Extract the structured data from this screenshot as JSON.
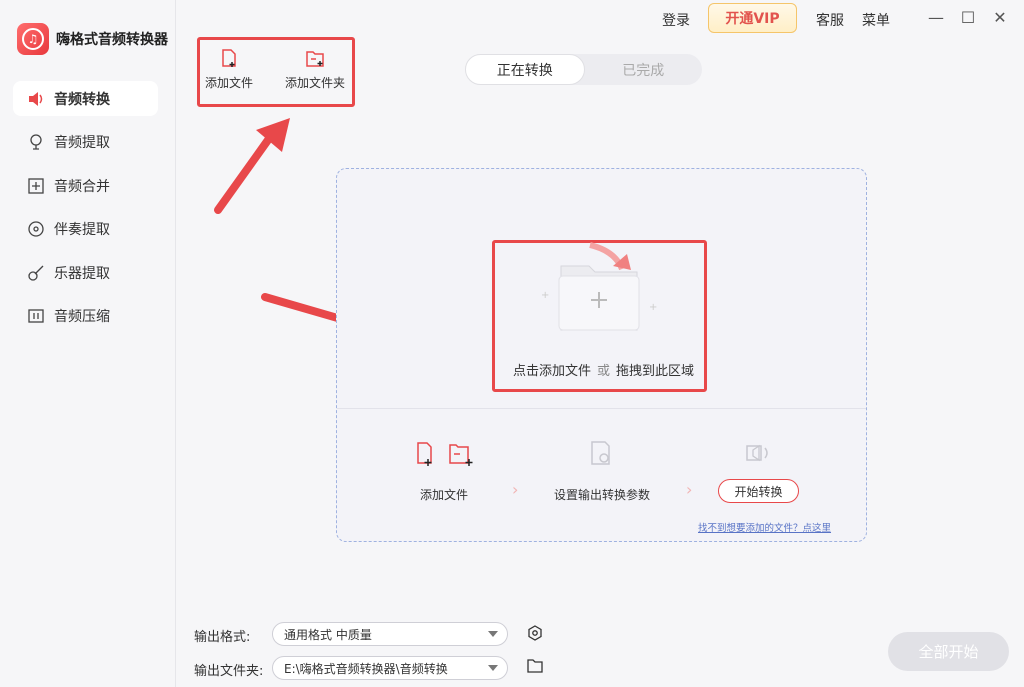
{
  "app": {
    "title": "嗨格式音频转换器"
  },
  "topbar": {
    "login": "登录",
    "vip": "开通VIP",
    "service": "客服",
    "menu": "菜单"
  },
  "sidebar": {
    "items": [
      {
        "label": "音频转换",
        "icon": "speaker-convert-icon"
      },
      {
        "label": "音频提取",
        "icon": "mic-extract-icon"
      },
      {
        "label": "音频合并",
        "icon": "merge-icon"
      },
      {
        "label": "伴奏提取",
        "icon": "disc-icon"
      },
      {
        "label": "乐器提取",
        "icon": "guitar-icon"
      },
      {
        "label": "音频压缩",
        "icon": "compress-icon"
      }
    ]
  },
  "toolbar": {
    "add_file": "添加文件",
    "add_folder": "添加文件夹"
  },
  "tabs": [
    "正在转换",
    "已完成"
  ],
  "dropzone": {
    "click_add": "点击添加文件",
    "or": "或",
    "drag": "拖拽到此区域",
    "steps": {
      "add_file": "添加文件",
      "set_params": "设置输出转换参数",
      "start": "开始转换"
    },
    "help": "找不到想要添加的文件？点这里"
  },
  "bottom": {
    "format_label": "输出格式:",
    "format_value": "通用格式 中质量",
    "folder_label": "输出文件夹:",
    "folder_value": "E:\\嗨格式音频转换器\\音频转换",
    "start_all": "全部开始"
  },
  "colors": {
    "accent": "#e8484a",
    "vip_bg": "#ffefc7",
    "dash_border": "#9fb2e0"
  }
}
